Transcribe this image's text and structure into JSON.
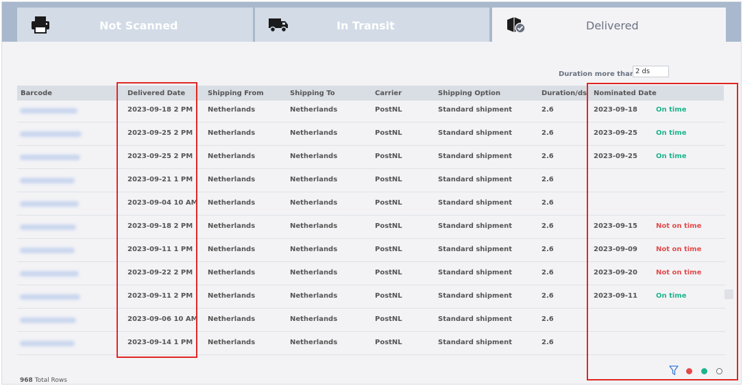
{
  "tabs": [
    {
      "label": "Not Scanned",
      "icon": "printer-icon",
      "active": false
    },
    {
      "label": "In Transit",
      "icon": "truck-icon",
      "active": false
    },
    {
      "label": "Delivered",
      "icon": "box-check-icon",
      "active": true
    }
  ],
  "filter": {
    "label": "Duration more than",
    "value": "2 ds"
  },
  "table": {
    "columns": [
      "Barcode",
      "Delivered Date",
      "Shipping From",
      "Shipping To",
      "Carrier",
      "Shipping Option",
      "Duration/ds",
      "Nominated Date"
    ],
    "rows": [
      {
        "delivered": "2023-09-18 2 PM",
        "from": "Netherlands",
        "to": "Netherlands",
        "carrier": "PostNL",
        "option": "Standard shipment",
        "duration": "2.6",
        "nominated": "2023-09-18",
        "status": "On time"
      },
      {
        "delivered": "2023-09-25 2 PM",
        "from": "Netherlands",
        "to": "Netherlands",
        "carrier": "PostNL",
        "option": "Standard shipment",
        "duration": "2.6",
        "nominated": "2023-09-25",
        "status": "On time"
      },
      {
        "delivered": "2023-09-25 2 PM",
        "from": "Netherlands",
        "to": "Netherlands",
        "carrier": "PostNL",
        "option": "Standard shipment",
        "duration": "2.6",
        "nominated": "2023-09-25",
        "status": "On time"
      },
      {
        "delivered": "2023-09-21 1 PM",
        "from": "Netherlands",
        "to": "Netherlands",
        "carrier": "PostNL",
        "option": "Standard shipment",
        "duration": "2.6",
        "nominated": "",
        "status": ""
      },
      {
        "delivered": "2023-09-04 10 AM",
        "from": "Netherlands",
        "to": "Netherlands",
        "carrier": "PostNL",
        "option": "Standard shipment",
        "duration": "2.6",
        "nominated": "",
        "status": ""
      },
      {
        "delivered": "2023-09-18 2 PM",
        "from": "Netherlands",
        "to": "Netherlands",
        "carrier": "PostNL",
        "option": "Standard shipment",
        "duration": "2.6",
        "nominated": "2023-09-15",
        "status": "Not on time"
      },
      {
        "delivered": "2023-09-11 1 PM",
        "from": "Netherlands",
        "to": "Netherlands",
        "carrier": "PostNL",
        "option": "Standard shipment",
        "duration": "2.6",
        "nominated": "2023-09-09",
        "status": "Not on time"
      },
      {
        "delivered": "2023-09-22 2 PM",
        "from": "Netherlands",
        "to": "Netherlands",
        "carrier": "PostNL",
        "option": "Standard shipment",
        "duration": "2.6",
        "nominated": "2023-09-20",
        "status": "Not on time"
      },
      {
        "delivered": "2023-09-11 2 PM",
        "from": "Netherlands",
        "to": "Netherlands",
        "carrier": "PostNL",
        "option": "Standard shipment",
        "duration": "2.6",
        "nominated": "2023-09-11",
        "status": "On time"
      },
      {
        "delivered": "2023-09-06 10 AM",
        "from": "Netherlands",
        "to": "Netherlands",
        "carrier": "PostNL",
        "option": "Standard shipment",
        "duration": "2.6",
        "nominated": "",
        "status": ""
      },
      {
        "delivered": "2023-09-14 1 PM",
        "from": "Netherlands",
        "to": "Netherlands",
        "carrier": "PostNL",
        "option": "Standard shipment",
        "duration": "2.6",
        "nominated": "",
        "status": ""
      }
    ]
  },
  "footer": {
    "total_count": "968",
    "total_label": "Total Rows"
  },
  "colors": {
    "on_time": "#1db48c",
    "not_on_time": "#e34a4a",
    "highlight": "#e0251f"
  },
  "legend_dots": [
    {
      "name": "red-status-dot",
      "color": "#e34a4a"
    },
    {
      "name": "green-status-dot",
      "color": "#1db48c"
    },
    {
      "name": "empty-status-dot",
      "color": "none"
    }
  ]
}
